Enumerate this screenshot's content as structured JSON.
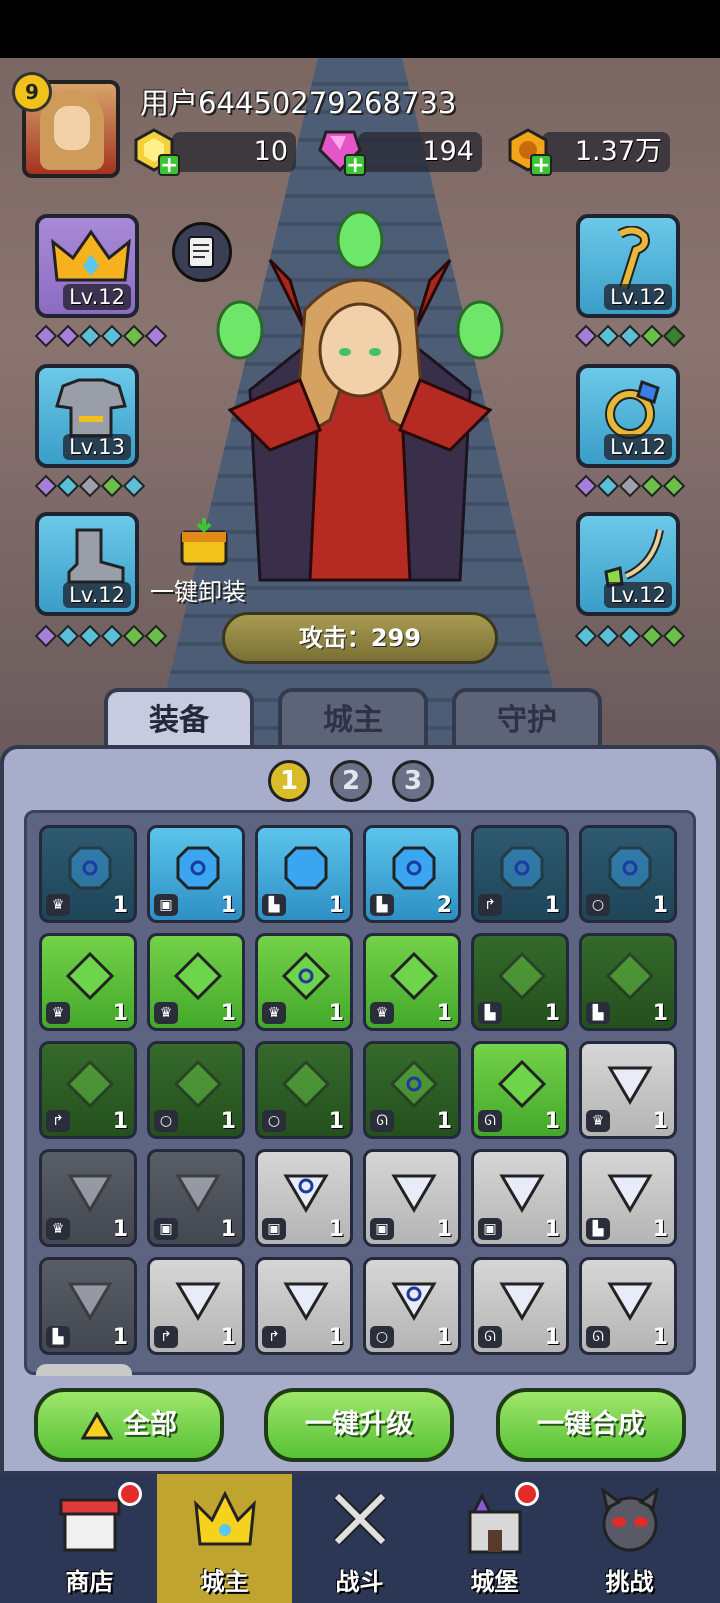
{
  "player": {
    "level": "9",
    "username": "用户64450279268733"
  },
  "resources": [
    {
      "name": "gold-ingot",
      "value": "10",
      "color": "#f2d13a"
    },
    {
      "name": "pink-gem",
      "value": "194",
      "color": "#e655c8"
    },
    {
      "name": "coin",
      "value": "1.37万",
      "color": "#f2a41a"
    }
  ],
  "equipment": {
    "left": [
      {
        "slot": "crown",
        "level": "Lv.12"
      },
      {
        "slot": "armor",
        "level": "Lv.13"
      },
      {
        "slot": "boots",
        "level": "Lv.12"
      }
    ],
    "right": [
      {
        "slot": "staff",
        "level": "Lv.12"
      },
      {
        "slot": "ring",
        "level": "Lv.12"
      },
      {
        "slot": "necklace",
        "level": "Lv.12"
      }
    ],
    "unequip_all_label": "一键卸装",
    "attack_label": "攻击：299"
  },
  "tabs": [
    {
      "label": "装备",
      "active": true
    },
    {
      "label": "城主",
      "active": false
    },
    {
      "label": "守护",
      "active": false
    }
  ],
  "pages": [
    "1",
    "2",
    "3"
  ],
  "active_page": "1",
  "inventory": [
    {
      "color": "dblue",
      "gem": "blue-swirl",
      "type": "crown",
      "count": "1"
    },
    {
      "color": "blue",
      "gem": "blue-swirl",
      "type": "armor",
      "count": "1"
    },
    {
      "color": "blue",
      "gem": "blue",
      "type": "boots",
      "count": "1"
    },
    {
      "color": "blue",
      "gem": "blue-swirl",
      "type": "boots",
      "count": "2"
    },
    {
      "color": "dblue",
      "gem": "blue-swirl",
      "type": "staff",
      "count": "1"
    },
    {
      "color": "dblue",
      "gem": "blue-swirl",
      "type": "ring",
      "count": "1"
    },
    {
      "color": "green",
      "gem": "green",
      "type": "crown",
      "count": "1"
    },
    {
      "color": "green",
      "gem": "green",
      "type": "crown",
      "count": "1"
    },
    {
      "color": "green",
      "gem": "green-swirl",
      "type": "crown",
      "count": "1"
    },
    {
      "color": "green",
      "gem": "green",
      "type": "crown",
      "count": "1"
    },
    {
      "color": "dgreen",
      "gem": "green",
      "type": "boots",
      "count": "1"
    },
    {
      "color": "dgreen",
      "gem": "green",
      "type": "boots",
      "count": "1"
    },
    {
      "color": "dgreen",
      "gem": "green",
      "type": "staff",
      "count": "1"
    },
    {
      "color": "dgreen",
      "gem": "green",
      "type": "ring",
      "count": "1"
    },
    {
      "color": "dgreen",
      "gem": "green",
      "type": "ring",
      "count": "1"
    },
    {
      "color": "dgreen",
      "gem": "green-swirl",
      "type": "necklace",
      "count": "1"
    },
    {
      "color": "green",
      "gem": "green",
      "type": "necklace",
      "count": "1"
    },
    {
      "color": "grey",
      "gem": "white",
      "type": "crown",
      "count": "1"
    },
    {
      "color": "dgrey",
      "gem": "white",
      "type": "crown",
      "count": "1"
    },
    {
      "color": "dgrey",
      "gem": "white",
      "type": "armor",
      "count": "1"
    },
    {
      "color": "grey",
      "gem": "white-swirl",
      "type": "armor",
      "count": "1"
    },
    {
      "color": "grey",
      "gem": "white",
      "type": "armor",
      "count": "1"
    },
    {
      "color": "grey",
      "gem": "white",
      "type": "armor",
      "count": "1"
    },
    {
      "color": "grey",
      "gem": "white",
      "type": "boots",
      "count": "1"
    },
    {
      "color": "dgrey",
      "gem": "white",
      "type": "boots",
      "count": "1"
    },
    {
      "color": "grey",
      "gem": "white",
      "type": "staff",
      "count": "1"
    },
    {
      "color": "grey",
      "gem": "white",
      "type": "staff",
      "count": "1"
    },
    {
      "color": "grey",
      "gem": "white-swirl",
      "type": "ring",
      "count": "1"
    },
    {
      "color": "grey",
      "gem": "white",
      "type": "necklace",
      "count": "1"
    },
    {
      "color": "grey",
      "gem": "white",
      "type": "necklace",
      "count": "1"
    }
  ],
  "actions": [
    {
      "label": "全部"
    },
    {
      "label": "一键升级"
    },
    {
      "label": "一键合成"
    }
  ],
  "nav": [
    {
      "label": "商店",
      "badge": true
    },
    {
      "label": "城主",
      "active": true
    },
    {
      "label": "战斗"
    },
    {
      "label": "城堡",
      "badge": true
    },
    {
      "label": "挑战"
    }
  ]
}
